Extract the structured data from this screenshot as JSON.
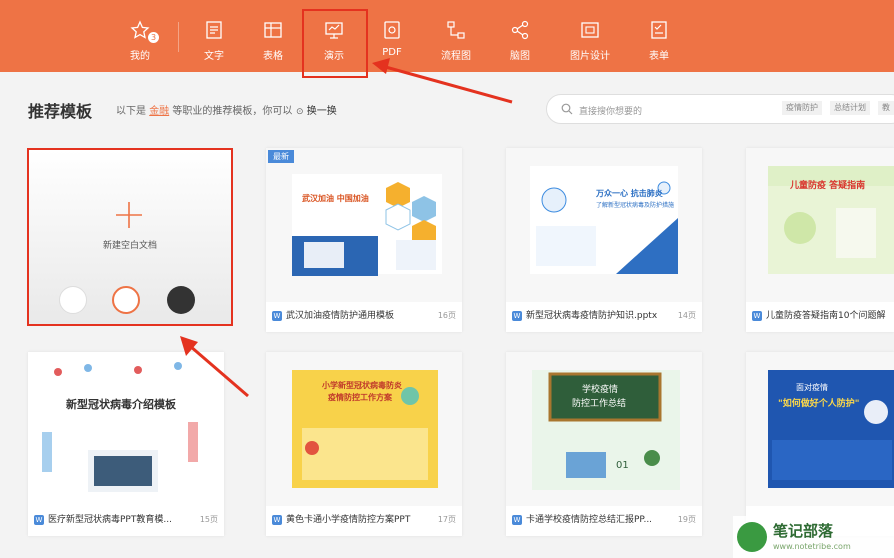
{
  "nav": {
    "items": [
      {
        "label": "我的",
        "icon": "star-user-icon",
        "badge": "3"
      },
      {
        "label": "文字",
        "icon": "document-icon"
      },
      {
        "label": "表格",
        "icon": "table-icon"
      },
      {
        "label": "演示",
        "icon": "presentation-icon",
        "active": true
      },
      {
        "label": "PDF",
        "icon": "pdf-icon"
      },
      {
        "label": "流程图",
        "icon": "flowchart-icon"
      },
      {
        "label": "脑图",
        "icon": "mindmap-icon"
      },
      {
        "label": "图片设计",
        "icon": "image-design-icon"
      },
      {
        "label": "表单",
        "icon": "form-icon"
      }
    ],
    "accent": "#ee7345"
  },
  "header": {
    "title": "推荐模板",
    "subtitle_pre": "以下是",
    "subtitle_highlight": "金融",
    "subtitle_post": "等职业的推荐模板，你可以",
    "swap_label": "换一换"
  },
  "search": {
    "placeholder": "直接搜你想要的",
    "tags": [
      "疫情防护",
      "总结计划",
      "教"
    ]
  },
  "new_doc": {
    "label": "新建空白文档",
    "colors": [
      "#ffffff",
      "#ffffff",
      "#333333"
    ]
  },
  "templates": [
    {
      "title": "武汉加油疫情防护通用模板",
      "pages": "16页",
      "badge": "最新"
    },
    {
      "title": "新型冠状病毒疫情防护知识.pptx",
      "pages": "14页"
    },
    {
      "title": "儿童防疫答疑指南10个问题解",
      "pages": ""
    },
    {
      "title": "医疗新型冠状病毒PPT教育模...",
      "pages": "15页"
    },
    {
      "title": "黄色卡通小学疫情防控方案PPT",
      "pages": "17页"
    },
    {
      "title": "卡通学校疫情防控总结汇报PP...",
      "pages": "19页"
    },
    {
      "title": "",
      "pages": ""
    }
  ],
  "thumb_text": {
    "t0_line1": "武汉加油 中国加油",
    "t1_line1": "万众一心 抗击肺炎",
    "t1_line2": "了解新型冠状病毒及防护措施",
    "t2_line1": "儿童防疫 答疑指南",
    "t3_line1": "新型冠状病毒介绍模板",
    "t4_line1": "小学新型冠状病毒防炎",
    "t4_line2": "疫情防控工作方案",
    "t5_line1": "学校疫情",
    "t5_line2": "防控工作总结",
    "t5_num": "01",
    "t6_line1": "面对疫情",
    "t6_line2": "\"如何做好个人防护\""
  },
  "watermark": {
    "text": "笔记部落",
    "url": "www.notetribe.com"
  }
}
